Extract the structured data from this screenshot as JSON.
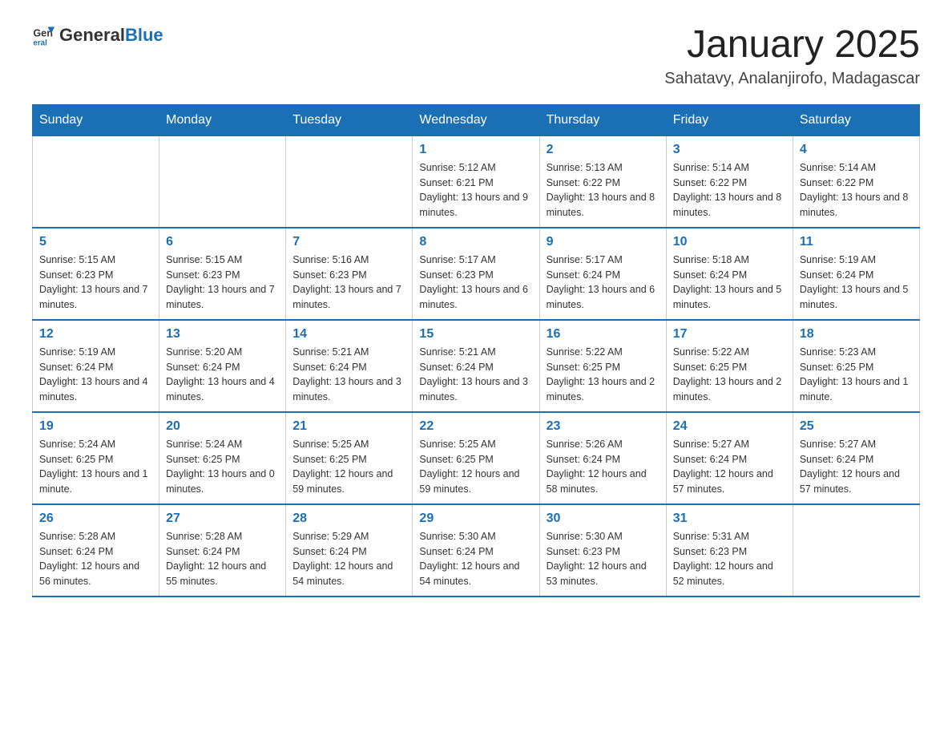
{
  "logo": {
    "text_general": "General",
    "text_blue": "Blue"
  },
  "title": "January 2025",
  "subtitle": "Sahatavy, Analanjirofo, Madagascar",
  "days_of_week": [
    "Sunday",
    "Monday",
    "Tuesday",
    "Wednesday",
    "Thursday",
    "Friday",
    "Saturday"
  ],
  "weeks": [
    [
      {
        "day": "",
        "info": ""
      },
      {
        "day": "",
        "info": ""
      },
      {
        "day": "",
        "info": ""
      },
      {
        "day": "1",
        "info": "Sunrise: 5:12 AM\nSunset: 6:21 PM\nDaylight: 13 hours and 9 minutes."
      },
      {
        "day": "2",
        "info": "Sunrise: 5:13 AM\nSunset: 6:22 PM\nDaylight: 13 hours and 8 minutes."
      },
      {
        "day": "3",
        "info": "Sunrise: 5:14 AM\nSunset: 6:22 PM\nDaylight: 13 hours and 8 minutes."
      },
      {
        "day": "4",
        "info": "Sunrise: 5:14 AM\nSunset: 6:22 PM\nDaylight: 13 hours and 8 minutes."
      }
    ],
    [
      {
        "day": "5",
        "info": "Sunrise: 5:15 AM\nSunset: 6:23 PM\nDaylight: 13 hours and 7 minutes."
      },
      {
        "day": "6",
        "info": "Sunrise: 5:15 AM\nSunset: 6:23 PM\nDaylight: 13 hours and 7 minutes."
      },
      {
        "day": "7",
        "info": "Sunrise: 5:16 AM\nSunset: 6:23 PM\nDaylight: 13 hours and 7 minutes."
      },
      {
        "day": "8",
        "info": "Sunrise: 5:17 AM\nSunset: 6:23 PM\nDaylight: 13 hours and 6 minutes."
      },
      {
        "day": "9",
        "info": "Sunrise: 5:17 AM\nSunset: 6:24 PM\nDaylight: 13 hours and 6 minutes."
      },
      {
        "day": "10",
        "info": "Sunrise: 5:18 AM\nSunset: 6:24 PM\nDaylight: 13 hours and 5 minutes."
      },
      {
        "day": "11",
        "info": "Sunrise: 5:19 AM\nSunset: 6:24 PM\nDaylight: 13 hours and 5 minutes."
      }
    ],
    [
      {
        "day": "12",
        "info": "Sunrise: 5:19 AM\nSunset: 6:24 PM\nDaylight: 13 hours and 4 minutes."
      },
      {
        "day": "13",
        "info": "Sunrise: 5:20 AM\nSunset: 6:24 PM\nDaylight: 13 hours and 4 minutes."
      },
      {
        "day": "14",
        "info": "Sunrise: 5:21 AM\nSunset: 6:24 PM\nDaylight: 13 hours and 3 minutes."
      },
      {
        "day": "15",
        "info": "Sunrise: 5:21 AM\nSunset: 6:24 PM\nDaylight: 13 hours and 3 minutes."
      },
      {
        "day": "16",
        "info": "Sunrise: 5:22 AM\nSunset: 6:25 PM\nDaylight: 13 hours and 2 minutes."
      },
      {
        "day": "17",
        "info": "Sunrise: 5:22 AM\nSunset: 6:25 PM\nDaylight: 13 hours and 2 minutes."
      },
      {
        "day": "18",
        "info": "Sunrise: 5:23 AM\nSunset: 6:25 PM\nDaylight: 13 hours and 1 minute."
      }
    ],
    [
      {
        "day": "19",
        "info": "Sunrise: 5:24 AM\nSunset: 6:25 PM\nDaylight: 13 hours and 1 minute."
      },
      {
        "day": "20",
        "info": "Sunrise: 5:24 AM\nSunset: 6:25 PM\nDaylight: 13 hours and 0 minutes."
      },
      {
        "day": "21",
        "info": "Sunrise: 5:25 AM\nSunset: 6:25 PM\nDaylight: 12 hours and 59 minutes."
      },
      {
        "day": "22",
        "info": "Sunrise: 5:25 AM\nSunset: 6:25 PM\nDaylight: 12 hours and 59 minutes."
      },
      {
        "day": "23",
        "info": "Sunrise: 5:26 AM\nSunset: 6:24 PM\nDaylight: 12 hours and 58 minutes."
      },
      {
        "day": "24",
        "info": "Sunrise: 5:27 AM\nSunset: 6:24 PM\nDaylight: 12 hours and 57 minutes."
      },
      {
        "day": "25",
        "info": "Sunrise: 5:27 AM\nSunset: 6:24 PM\nDaylight: 12 hours and 57 minutes."
      }
    ],
    [
      {
        "day": "26",
        "info": "Sunrise: 5:28 AM\nSunset: 6:24 PM\nDaylight: 12 hours and 56 minutes."
      },
      {
        "day": "27",
        "info": "Sunrise: 5:28 AM\nSunset: 6:24 PM\nDaylight: 12 hours and 55 minutes."
      },
      {
        "day": "28",
        "info": "Sunrise: 5:29 AM\nSunset: 6:24 PM\nDaylight: 12 hours and 54 minutes."
      },
      {
        "day": "29",
        "info": "Sunrise: 5:30 AM\nSunset: 6:24 PM\nDaylight: 12 hours and 54 minutes."
      },
      {
        "day": "30",
        "info": "Sunrise: 5:30 AM\nSunset: 6:23 PM\nDaylight: 12 hours and 53 minutes."
      },
      {
        "day": "31",
        "info": "Sunrise: 5:31 AM\nSunset: 6:23 PM\nDaylight: 12 hours and 52 minutes."
      },
      {
        "day": "",
        "info": ""
      }
    ]
  ]
}
